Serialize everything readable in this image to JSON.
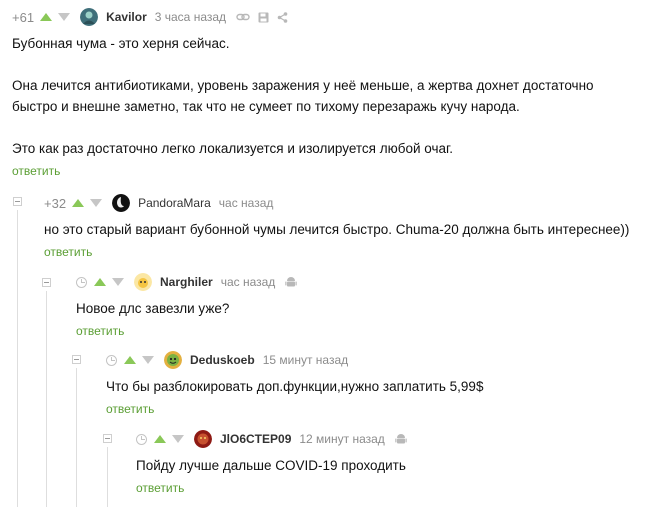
{
  "comments": [
    {
      "rating": "+61",
      "author": "Kavilor",
      "time": "3 часа назад",
      "paragraphs": [
        "Бубонная чума - это херня сейчас.",
        "Она лечится антибиотиками, уровень заражения у неё меньше, а жертва дохнет достаточно быстро и внешне заметно, так что не сумеет по тихому перезаражь кучу народа.",
        "Это как раз достаточно легко локализуется и изолируется любой очаг."
      ],
      "reply": "ответить"
    },
    {
      "rating": "+32",
      "author": "PandoraMara",
      "time": "час назад",
      "text": "но это старый вариант бубонной чумы лечится быстро. Chuma-20 должна быть интереснее))",
      "reply": "ответить"
    },
    {
      "author": "Narghiler",
      "time": "час назад",
      "text": "Новое длс завезли уже?",
      "reply": "ответить"
    },
    {
      "author": "Deduskoeb",
      "time": "15 минут назад",
      "text": "Что бы разблокировать доп.функции,нужно заплатить 5,99$",
      "reply": "ответить"
    },
    {
      "author": "JlO6CTEP09",
      "time": "12 минут назад",
      "text": "Пойду лучше дальше COVID-19 проходить",
      "reply": "ответить"
    }
  ],
  "icons": {
    "link": "link-icon",
    "save": "save-icon",
    "share": "share-icon",
    "clock": "clock-icon",
    "device": "android-icon"
  },
  "colors": {
    "accent_green": "#8ac858",
    "reply_green": "#5a9e33",
    "muted": "#8b8b8b"
  }
}
